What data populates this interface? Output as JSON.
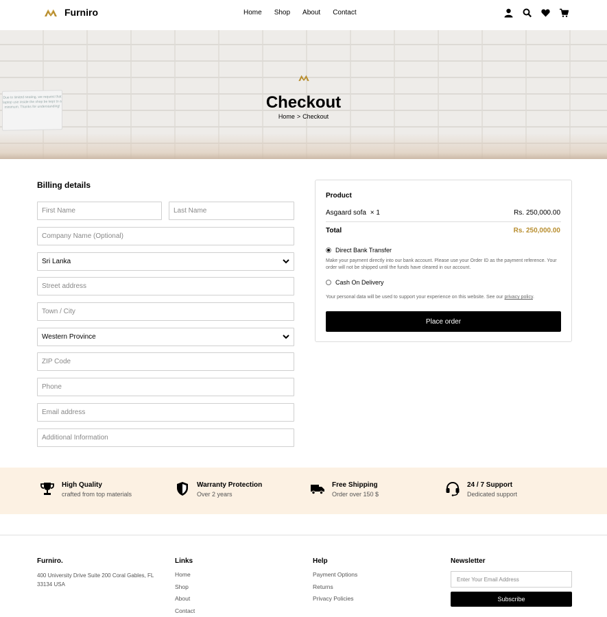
{
  "brand": {
    "name": "Furniro",
    "accent_color": "#b88e2f"
  },
  "nav": {
    "items": [
      "Home",
      "Shop",
      "About",
      "Contact"
    ]
  },
  "header_icons": [
    "user-icon",
    "search-icon",
    "heart-icon",
    "cart-icon"
  ],
  "hero": {
    "title": "Checkout",
    "breadcrumb": {
      "home": "Home",
      "separator": ">",
      "current": "Checkout"
    },
    "sign_text": "Due to limited seating, we request that laptop use inside the shop be kept to a minimum. Thanks for understanding!"
  },
  "billing": {
    "title": "Billing details",
    "first_name": {
      "placeholder": "First Name"
    },
    "last_name": {
      "placeholder": "Last Name"
    },
    "company": {
      "placeholder": "Company Name (Optional)"
    },
    "country": {
      "value": "Sri Lanka"
    },
    "street": {
      "placeholder": "Street address"
    },
    "town": {
      "placeholder": "Town / City"
    },
    "province": {
      "value": "Western Province"
    },
    "zip": {
      "placeholder": "ZIP Code"
    },
    "phone": {
      "placeholder": "Phone"
    },
    "email": {
      "placeholder": "Email address"
    },
    "additional": {
      "placeholder": "Additional Information"
    }
  },
  "order": {
    "heading": "Product",
    "item_name": "Asgaard sofa",
    "item_qty": "× 1",
    "item_price": "Rs. 250,000.00",
    "total_label": "Total",
    "total_price": "Rs. 250,000.00",
    "payment_methods": [
      {
        "label": "Direct Bank Transfer",
        "selected": true
      },
      {
        "label": "Cash On Delivery",
        "selected": false
      }
    ],
    "bank_transfer_desc": "Make your payment directly into our bank account. Please use your Order ID as the payment reference. Your order will not be shipped until the funds have cleared in our account.",
    "privacy_text": "Your personal data will be used to support your experience on this website. See our",
    "privacy_link": "privacy policy",
    "privacy_end": ".",
    "place_order_label": "Place order"
  },
  "features": [
    {
      "icon": "trophy-icon",
      "title": "High Quality",
      "subtitle": "crafted from top materials"
    },
    {
      "icon": "shield-icon",
      "title": "Warranty Protection",
      "subtitle": "Over 2 years"
    },
    {
      "icon": "truck-icon",
      "title": "Free Shipping",
      "subtitle": "Order over 150 $"
    },
    {
      "icon": "headset-icon",
      "title": "24 / 7 Support",
      "subtitle": "Dedicated support"
    }
  ],
  "footer": {
    "brand": "Furniro.",
    "address": "400 University Drive Suite 200 Coral Gables, FL 33134 USA",
    "links_title": "Links",
    "links": [
      "Home",
      "Shop",
      "About",
      "Contact"
    ],
    "help_title": "Help",
    "help": [
      "Payment Options",
      "Returns",
      "Privacy Policies"
    ],
    "newsletter_title": "Newsletter",
    "newsletter_placeholder": "Enter Your Email Address",
    "subscribe_label": "Subscribe"
  }
}
